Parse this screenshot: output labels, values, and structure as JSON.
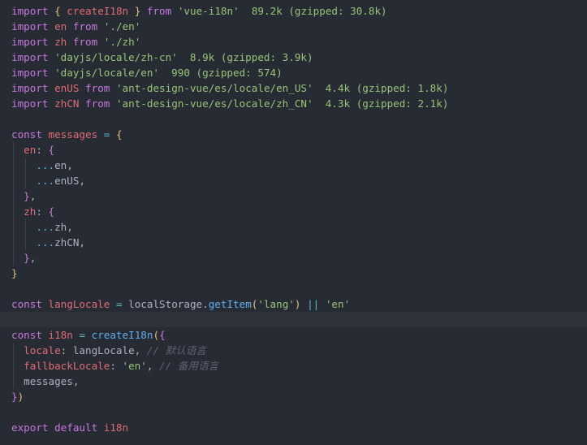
{
  "editor": {
    "theme_colors": {
      "background": "#272b33",
      "keyword": "#c678dd",
      "function": "#61afef",
      "string": "#98c379",
      "property": "#e06c75",
      "operator": "#56b6c2",
      "comment": "#5c6370",
      "bracket": "#e5c07b",
      "text": "#abb2bf"
    },
    "current_line": 20,
    "lines": [
      {
        "indent": 0,
        "tokens": [
          {
            "t": "kw",
            "v": "import"
          },
          {
            "t": "plain",
            "v": " "
          },
          {
            "t": "b1",
            "v": "{"
          },
          {
            "t": "plain",
            "v": " "
          },
          {
            "t": "prop",
            "v": "createI18n"
          },
          {
            "t": "plain",
            "v": " "
          },
          {
            "t": "b1",
            "v": "}"
          },
          {
            "t": "plain",
            "v": " "
          },
          {
            "t": "kw",
            "v": "from"
          },
          {
            "t": "plain",
            "v": " "
          },
          {
            "t": "str",
            "v": "'vue-i18n'"
          },
          {
            "t": "plain",
            "v": "  "
          },
          {
            "t": "size",
            "v": "89.2k (gzipped: 30.8k)"
          }
        ]
      },
      {
        "indent": 0,
        "tokens": [
          {
            "t": "kw",
            "v": "import"
          },
          {
            "t": "plain",
            "v": " "
          },
          {
            "t": "prop",
            "v": "en"
          },
          {
            "t": "plain",
            "v": " "
          },
          {
            "t": "kw",
            "v": "from"
          },
          {
            "t": "plain",
            "v": " "
          },
          {
            "t": "str",
            "v": "'./en'"
          }
        ]
      },
      {
        "indent": 0,
        "tokens": [
          {
            "t": "kw",
            "v": "import"
          },
          {
            "t": "plain",
            "v": " "
          },
          {
            "t": "prop",
            "v": "zh"
          },
          {
            "t": "plain",
            "v": " "
          },
          {
            "t": "kw",
            "v": "from"
          },
          {
            "t": "plain",
            "v": " "
          },
          {
            "t": "str",
            "v": "'./zh'"
          }
        ]
      },
      {
        "indent": 0,
        "tokens": [
          {
            "t": "kw",
            "v": "import"
          },
          {
            "t": "plain",
            "v": " "
          },
          {
            "t": "str",
            "v": "'dayjs/locale/zh-cn'"
          },
          {
            "t": "plain",
            "v": "  "
          },
          {
            "t": "size",
            "v": "8.9k (gzipped: 3.9k)"
          }
        ]
      },
      {
        "indent": 0,
        "tokens": [
          {
            "t": "kw",
            "v": "import"
          },
          {
            "t": "plain",
            "v": " "
          },
          {
            "t": "str",
            "v": "'dayjs/locale/en'"
          },
          {
            "t": "plain",
            "v": "  "
          },
          {
            "t": "size",
            "v": "990 (gzipped: 574)"
          }
        ]
      },
      {
        "indent": 0,
        "tokens": [
          {
            "t": "kw",
            "v": "import"
          },
          {
            "t": "plain",
            "v": " "
          },
          {
            "t": "prop",
            "v": "enUS"
          },
          {
            "t": "plain",
            "v": " "
          },
          {
            "t": "kw",
            "v": "from"
          },
          {
            "t": "plain",
            "v": " "
          },
          {
            "t": "str",
            "v": "'ant-design-vue/es/locale/en_US'"
          },
          {
            "t": "plain",
            "v": "  "
          },
          {
            "t": "size",
            "v": "4.4k (gzipped: 1.8k)"
          }
        ]
      },
      {
        "indent": 0,
        "tokens": [
          {
            "t": "kw",
            "v": "import"
          },
          {
            "t": "plain",
            "v": " "
          },
          {
            "t": "prop",
            "v": "zhCN"
          },
          {
            "t": "plain",
            "v": " "
          },
          {
            "t": "kw",
            "v": "from"
          },
          {
            "t": "plain",
            "v": " "
          },
          {
            "t": "str",
            "v": "'ant-design-vue/es/locale/zh_CN'"
          },
          {
            "t": "plain",
            "v": "  "
          },
          {
            "t": "size",
            "v": "4.3k (gzipped: 2.1k)"
          }
        ]
      },
      {
        "indent": 0,
        "tokens": []
      },
      {
        "indent": 0,
        "tokens": [
          {
            "t": "kw",
            "v": "const"
          },
          {
            "t": "plain",
            "v": " "
          },
          {
            "t": "prop",
            "v": "messages"
          },
          {
            "t": "plain",
            "v": " "
          },
          {
            "t": "op",
            "v": "="
          },
          {
            "t": "plain",
            "v": " "
          },
          {
            "t": "b1",
            "v": "{"
          }
        ]
      },
      {
        "indent": 1,
        "tokens": [
          {
            "t": "plain",
            "v": "  "
          },
          {
            "t": "prop",
            "v": "en"
          },
          {
            "t": "plain",
            "v": ": "
          },
          {
            "t": "b2",
            "v": "{"
          }
        ]
      },
      {
        "indent": 2,
        "tokens": [
          {
            "t": "plain",
            "v": "    "
          },
          {
            "t": "op",
            "v": "..."
          },
          {
            "t": "plain",
            "v": "en,"
          }
        ]
      },
      {
        "indent": 2,
        "tokens": [
          {
            "t": "plain",
            "v": "    "
          },
          {
            "t": "op",
            "v": "..."
          },
          {
            "t": "plain",
            "v": "enUS,"
          }
        ]
      },
      {
        "indent": 1,
        "tokens": [
          {
            "t": "plain",
            "v": "  "
          },
          {
            "t": "b2",
            "v": "}"
          },
          {
            "t": "plain",
            "v": ","
          }
        ]
      },
      {
        "indent": 1,
        "tokens": [
          {
            "t": "plain",
            "v": "  "
          },
          {
            "t": "prop",
            "v": "zh"
          },
          {
            "t": "plain",
            "v": ": "
          },
          {
            "t": "b2",
            "v": "{"
          }
        ]
      },
      {
        "indent": 2,
        "tokens": [
          {
            "t": "plain",
            "v": "    "
          },
          {
            "t": "op",
            "v": "..."
          },
          {
            "t": "plain",
            "v": "zh,"
          }
        ]
      },
      {
        "indent": 2,
        "tokens": [
          {
            "t": "plain",
            "v": "    "
          },
          {
            "t": "op",
            "v": "..."
          },
          {
            "t": "plain",
            "v": "zhCN,"
          }
        ]
      },
      {
        "indent": 1,
        "tokens": [
          {
            "t": "plain",
            "v": "  "
          },
          {
            "t": "b2",
            "v": "}"
          },
          {
            "t": "plain",
            "v": ","
          }
        ]
      },
      {
        "indent": 0,
        "tokens": [
          {
            "t": "b1",
            "v": "}"
          }
        ]
      },
      {
        "indent": 0,
        "tokens": []
      },
      {
        "indent": 0,
        "tokens": [
          {
            "t": "kw",
            "v": "const"
          },
          {
            "t": "plain",
            "v": " "
          },
          {
            "t": "prop",
            "v": "langLocale"
          },
          {
            "t": "plain",
            "v": " "
          },
          {
            "t": "op",
            "v": "="
          },
          {
            "t": "plain",
            "v": " "
          },
          {
            "t": "plain",
            "v": "localStorage."
          },
          {
            "t": "fn",
            "v": "getItem"
          },
          {
            "t": "b1",
            "v": "("
          },
          {
            "t": "str",
            "v": "'lang'"
          },
          {
            "t": "b1",
            "v": ")"
          },
          {
            "t": "plain",
            "v": " "
          },
          {
            "t": "op",
            "v": "||"
          },
          {
            "t": "plain",
            "v": " "
          },
          {
            "t": "str",
            "v": "'en'"
          }
        ]
      },
      {
        "indent": 0,
        "tokens": []
      },
      {
        "indent": 0,
        "tokens": [
          {
            "t": "kw",
            "v": "const"
          },
          {
            "t": "plain",
            "v": " "
          },
          {
            "t": "prop",
            "v": "i18n"
          },
          {
            "t": "plain",
            "v": " "
          },
          {
            "t": "op",
            "v": "="
          },
          {
            "t": "plain",
            "v": " "
          },
          {
            "t": "fn",
            "v": "createI18n"
          },
          {
            "t": "b1",
            "v": "("
          },
          {
            "t": "b2",
            "v": "{"
          }
        ]
      },
      {
        "indent": 1,
        "tokens": [
          {
            "t": "plain",
            "v": "  "
          },
          {
            "t": "prop",
            "v": "locale"
          },
          {
            "t": "plain",
            "v": ": langLocale, "
          },
          {
            "t": "cm",
            "v": "// 默认语言"
          }
        ]
      },
      {
        "indent": 1,
        "tokens": [
          {
            "t": "plain",
            "v": "  "
          },
          {
            "t": "prop",
            "v": "fallbackLocale"
          },
          {
            "t": "plain",
            "v": ": "
          },
          {
            "t": "str",
            "v": "'en'"
          },
          {
            "t": "plain",
            "v": ", "
          },
          {
            "t": "cm",
            "v": "// 备用语言"
          }
        ]
      },
      {
        "indent": 1,
        "tokens": [
          {
            "t": "plain",
            "v": "  messages,"
          }
        ]
      },
      {
        "indent": 0,
        "tokens": [
          {
            "t": "b2",
            "v": "}"
          },
          {
            "t": "b1",
            "v": ")"
          }
        ]
      },
      {
        "indent": 0,
        "tokens": []
      },
      {
        "indent": 0,
        "tokens": [
          {
            "t": "kw",
            "v": "export"
          },
          {
            "t": "plain",
            "v": " "
          },
          {
            "t": "kw",
            "v": "default"
          },
          {
            "t": "plain",
            "v": " "
          },
          {
            "t": "prop",
            "v": "i18n"
          }
        ]
      }
    ]
  }
}
